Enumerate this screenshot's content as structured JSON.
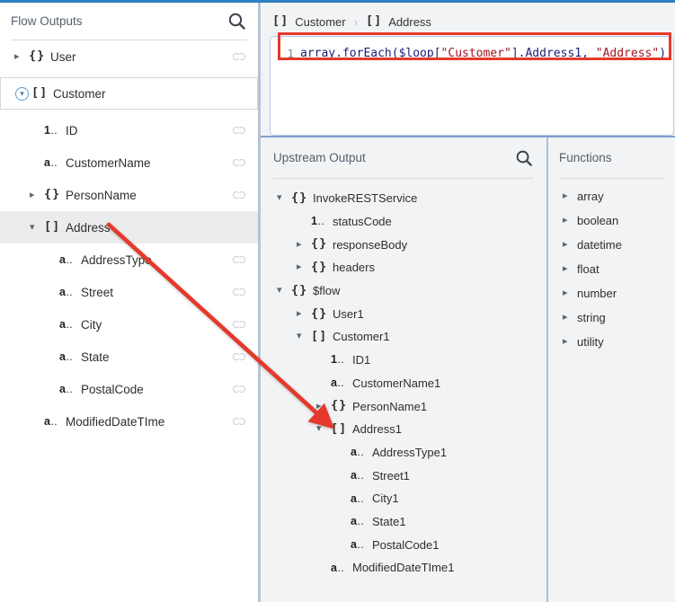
{
  "colors": {
    "top_border_blue": "#2f80c3",
    "panel_divider": "#b6c3d6",
    "editor_divider": "#7fa1cd",
    "annotation_red": "#e5392b",
    "code_plain": "#1d1d75",
    "code_string": "#a31621",
    "selected_row_bg": "#ececec"
  },
  "type_icon_glyphs": {
    "object": "{}",
    "array": "[]",
    "string": "a",
    "number": "1",
    "scalar_suffix": ".."
  },
  "left_panel": {
    "title": "Flow Outputs",
    "items": [
      {
        "label": "User",
        "type": "object",
        "level": 0,
        "expand": "collapsed",
        "link": true,
        "style": "plain"
      },
      {
        "label": "Customer",
        "type": "array",
        "level": 0,
        "expand": "expanded-circled",
        "link": false,
        "style": "boxed"
      },
      {
        "label": "ID",
        "type": "number",
        "level": 1,
        "expand": "none",
        "link": true,
        "style": "plain"
      },
      {
        "label": "CustomerName",
        "type": "string",
        "level": 1,
        "expand": "none",
        "link": true,
        "style": "plain"
      },
      {
        "label": "PersonName",
        "type": "object",
        "level": 1,
        "expand": "collapsed",
        "link": true,
        "style": "plain"
      },
      {
        "label": "Address",
        "type": "array",
        "level": 1,
        "expand": "expanded",
        "link": false,
        "style": "highlight"
      },
      {
        "label": "AddressType",
        "type": "string",
        "level": 2,
        "expand": "none",
        "link": true,
        "style": "plain"
      },
      {
        "label": "Street",
        "type": "string",
        "level": 2,
        "expand": "none",
        "link": true,
        "style": "plain"
      },
      {
        "label": "City",
        "type": "string",
        "level": 2,
        "expand": "none",
        "link": true,
        "style": "plain"
      },
      {
        "label": "State",
        "type": "string",
        "level": 2,
        "expand": "none",
        "link": true,
        "style": "plain"
      },
      {
        "label": "PostalCode",
        "type": "string",
        "level": 2,
        "expand": "none",
        "link": true,
        "style": "plain"
      },
      {
        "label": "ModifiedDateTIme",
        "type": "string",
        "level": 1,
        "expand": "none",
        "link": true,
        "style": "plain"
      }
    ]
  },
  "expression_editor": {
    "breadcrumb": [
      {
        "icon": "array",
        "label": "Customer"
      },
      {
        "icon": "array",
        "label": "Address"
      }
    ],
    "breadcrumb_separator": "›",
    "line_number": "1",
    "code_tokens": [
      {
        "text": "array.forEach($loop[",
        "style": "plain"
      },
      {
        "text": "\"Customer\"",
        "style": "string"
      },
      {
        "text": "].Address1, ",
        "style": "plain"
      },
      {
        "text": "\"Address\"",
        "style": "string"
      },
      {
        "text": ")",
        "style": "plain"
      }
    ]
  },
  "upstream_panel": {
    "title": "Upstream Output",
    "items": [
      {
        "label": "InvokeRESTService",
        "type": "object",
        "level": 0,
        "expand": "expanded"
      },
      {
        "label": "statusCode",
        "type": "number",
        "level": 1,
        "expand": "none"
      },
      {
        "label": "responseBody",
        "type": "object",
        "level": 1,
        "expand": "collapsed"
      },
      {
        "label": "headers",
        "type": "object",
        "level": 1,
        "expand": "collapsed"
      },
      {
        "label": "$flow",
        "type": "object",
        "level": 0,
        "expand": "expanded"
      },
      {
        "label": "User1",
        "type": "object",
        "level": 1,
        "expand": "collapsed"
      },
      {
        "label": "Customer1",
        "type": "array",
        "level": 1,
        "expand": "expanded"
      },
      {
        "label": "ID1",
        "type": "number",
        "level": 2,
        "expand": "none"
      },
      {
        "label": "CustomerName1",
        "type": "string",
        "level": 2,
        "expand": "none"
      },
      {
        "label": "PersonName1",
        "type": "object",
        "level": 2,
        "expand": "collapsed"
      },
      {
        "label": "Address1",
        "type": "array",
        "level": 2,
        "expand": "expanded"
      },
      {
        "label": "AddressType1",
        "type": "string",
        "level": 3,
        "expand": "none"
      },
      {
        "label": "Street1",
        "type": "string",
        "level": 3,
        "expand": "none"
      },
      {
        "label": "City1",
        "type": "string",
        "level": 3,
        "expand": "none"
      },
      {
        "label": "State1",
        "type": "string",
        "level": 3,
        "expand": "none"
      },
      {
        "label": "PostalCode1",
        "type": "string",
        "level": 3,
        "expand": "none"
      },
      {
        "label": "ModifiedDateTIme1",
        "type": "string",
        "level": 2,
        "expand": "none"
      }
    ]
  },
  "functions_panel": {
    "title": "Functions",
    "items": [
      {
        "label": "array"
      },
      {
        "label": "boolean"
      },
      {
        "label": "datetime"
      },
      {
        "label": "float"
      },
      {
        "label": "number"
      },
      {
        "label": "string"
      },
      {
        "label": "utility"
      }
    ]
  }
}
